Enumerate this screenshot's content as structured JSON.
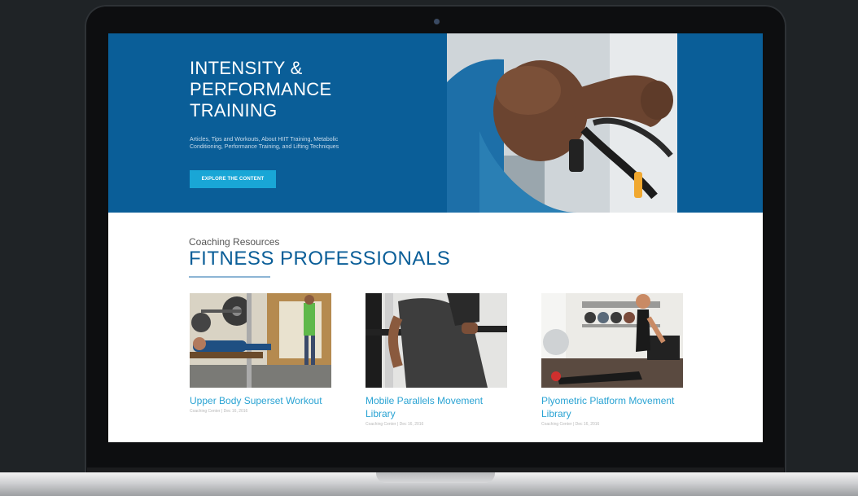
{
  "hero": {
    "title_lines": [
      "INTENSITY &",
      "PERFORMANCE",
      "TRAINING"
    ],
    "description": "Articles, Tips and Workouts, About HIIT Training, Metabolic Conditioning, Performance Training, and Lifting Techniques",
    "cta_label": "EXPLORE THE CONTENT"
  },
  "section": {
    "eyebrow": "Coaching Resources",
    "title": "FITNESS PROFESSIONALS"
  },
  "cards": [
    {
      "title": "Upper Body Superset Workout",
      "meta": "Coaching Center | Dec 16, 2016"
    },
    {
      "title": "Mobile Parallels Movement Library",
      "meta": "Coaching Center | Dec 16, 2016"
    },
    {
      "title": "Plyometric Platform Movement Library",
      "meta": "Coaching Center | Dec 16, 2016"
    }
  ],
  "colors": {
    "brand_blue": "#0a5e98",
    "cta_blue": "#19a6d6",
    "link_blue": "#29a3d3"
  }
}
